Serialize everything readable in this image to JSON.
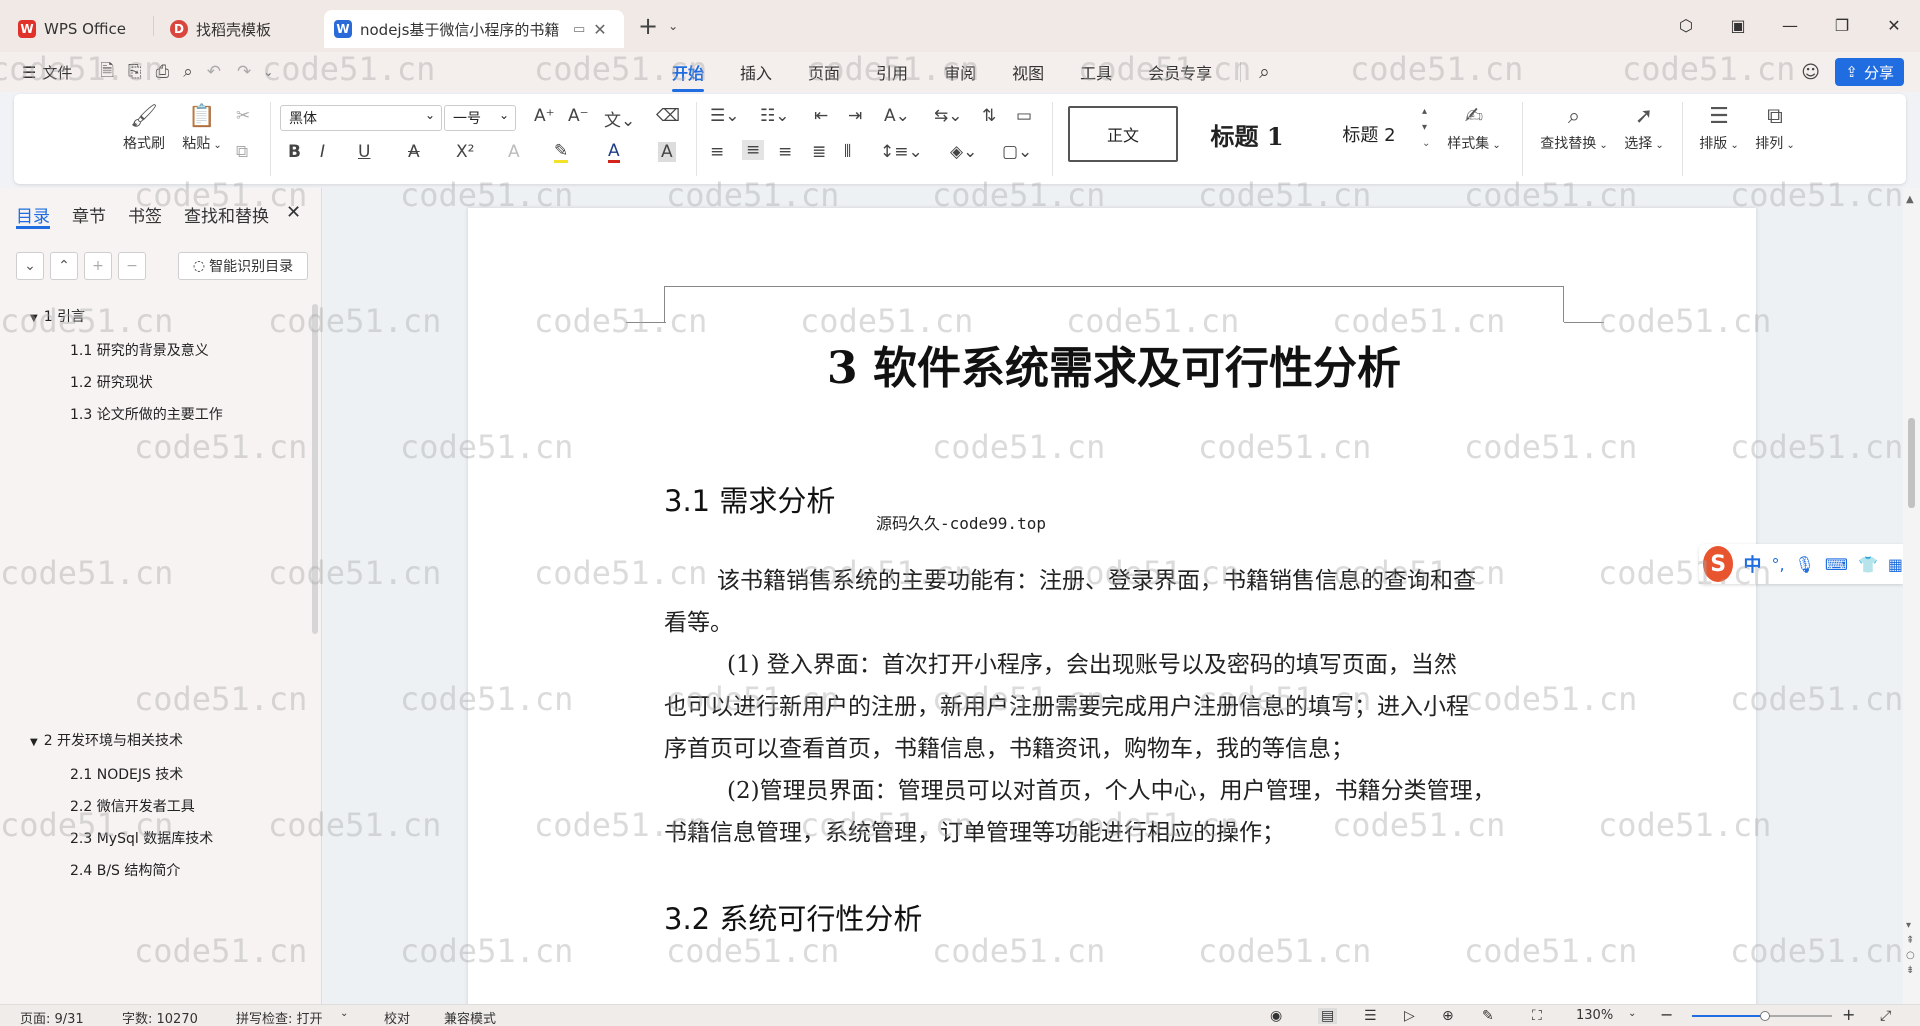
{
  "tabs": [
    {
      "label": "WPS Office",
      "logo": "W"
    },
    {
      "label": "找稻壳模板",
      "logo": "D"
    },
    {
      "label": "nodejs基于微信小程序的书籍",
      "logo": "W"
    }
  ],
  "menu": {
    "file": "文件",
    "items": [
      "开始",
      "插入",
      "页面",
      "引用",
      "审阅",
      "视图",
      "工具",
      "会员专享"
    ],
    "share": "分享"
  },
  "ribbon": {
    "format_painter": "格式刷",
    "paste": "粘贴",
    "font_name": "黑体",
    "font_size": "一号",
    "styles": [
      "正文",
      "标题 1",
      "标题 2"
    ],
    "style_set": "样式集",
    "find_replace": "查找替换",
    "select": "选择",
    "layout": "排版",
    "arrange": "排列"
  },
  "left_pane": {
    "tabs": [
      "目录",
      "章节",
      "书签",
      "查找和替换"
    ],
    "smart_toc": "智能识别目录",
    "toc": [
      {
        "label": "1 引言",
        "level": 1
      },
      {
        "label": "1.1 研究的背景及意义",
        "level": 2
      },
      {
        "label": "1.2 研究现状",
        "level": 2
      },
      {
        "label": "1.3 论文所做的主要工作",
        "level": 2
      },
      {
        "label": "2 开发环境与相关技术",
        "level": 1
      },
      {
        "label": "2.1 NODEJS 技术",
        "level": 2
      },
      {
        "label": "2.2 微信开发者工具",
        "level": 2
      },
      {
        "label": "2.3 MySql 数据库技术",
        "level": 2
      },
      {
        "label": "2.4 B/S 结构简介",
        "level": 2
      }
    ]
  },
  "document": {
    "chapter_title": "3  软件系统需求及可行性分析",
    "section1": "3.1 需求分析",
    "source_note": "源码久久-code99.top",
    "para1_line1": "该书籍销售系统的主要功能有：注册、登录界面，书籍销售信息的查询和查",
    "para1_line2": "看等。",
    "para2_line1": "(1) 登入界面：首次打开小程序，会出现账号以及密码的填写页面，当然",
    "para2_line2": "也可以进行新用户的注册，新用户注册需要完成用户注册信息的填写；进入小程",
    "para2_line3": "序首页可以查看首页，书籍信息，书籍资讯，购物车，我的等信息；",
    "para3_line1": "(2)管理员界面：管理员可以对首页，个人中心，用户管理，书籍分类管理，",
    "para3_line2": "书籍信息管理，系统管理，订单管理等功能进行相应的操作；",
    "section2": "3.2 系统可行性分析"
  },
  "ime": {
    "mode": "中"
  },
  "status": {
    "page": "页面: 9/31",
    "words": "字数: 10270",
    "spell": "拼写检查: 打开",
    "proof": "校对",
    "compat": "兼容模式",
    "zoom": "130%"
  },
  "watermark": "code51.cn",
  "colors": {
    "accent": "#1f6de0",
    "wps_red": "#e0322a"
  }
}
